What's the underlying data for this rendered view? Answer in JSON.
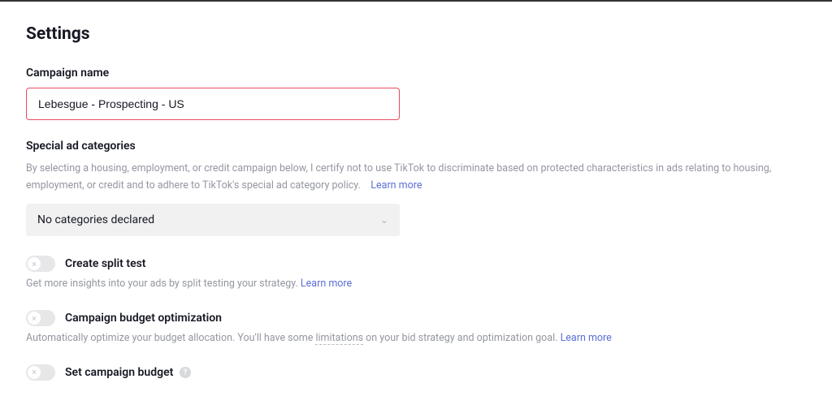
{
  "page_title": "Settings",
  "campaign_name": {
    "label": "Campaign name",
    "value": "Lebesgue - Prospecting - US"
  },
  "special_categories": {
    "label": "Special ad categories",
    "description": "By selecting a housing, employment, or credit campaign below, I certify not to use TikTok to discriminate based on protected characteristics in ads relating to housing, employment, or credit and to adhere to TikTok's special ad category policy.",
    "learn_more": "Learn more",
    "selected": "No categories declared"
  },
  "split_test": {
    "label": "Create split test",
    "description": "Get more insights into your ads by split testing your strategy.",
    "learn_more": "Learn more"
  },
  "budget_optimization": {
    "label": "Campaign budget optimization",
    "desc_pre": "Automatically optimize your budget allocation. You'll have some ",
    "desc_mid": "limitations",
    "desc_post": " on your bid strategy and optimization goal.",
    "learn_more": "Learn more"
  },
  "set_budget": {
    "label": "Set campaign budget"
  }
}
